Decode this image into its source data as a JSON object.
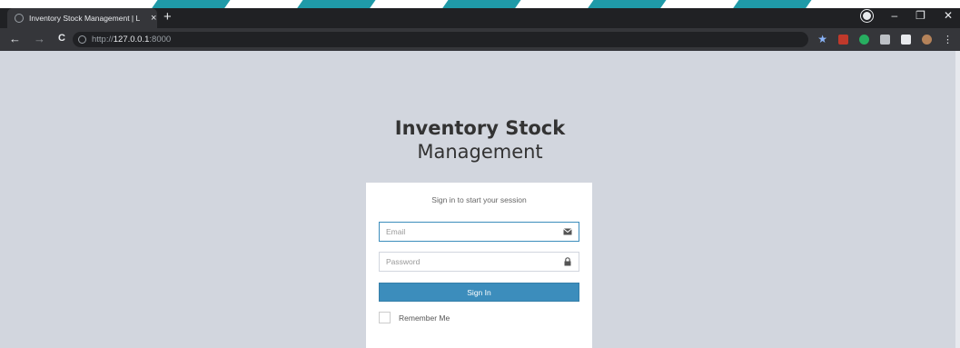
{
  "browser": {
    "tab_title": "Inventory Stock Management | L",
    "tab_close": "×",
    "new_tab": "+",
    "back": "←",
    "forward": "→",
    "reload": "C",
    "url_scheme": "http://",
    "url_host": "127.0.0.1",
    "url_port": ":8000",
    "minimize": "–",
    "restore": "❐",
    "close": "✕",
    "bookmark_star": "★",
    "menu": "⋮"
  },
  "page": {
    "logo_line1": "Inventory Stock",
    "logo_line2": "Management",
    "login_message": "Sign in to start your session",
    "email_placeholder": "Email",
    "password_placeholder": "Password",
    "signin_label": "Sign In",
    "remember_label": "Remember Me"
  },
  "colors": {
    "page_bg": "#d2d6de",
    "primary": "#3c8dbc",
    "chrome_dark": "#202124",
    "chrome_mid": "#35363a",
    "stripe_teal": "#1f9aa8"
  },
  "icons": {
    "email_field": "envelope-icon",
    "password_field": "lock-icon"
  }
}
